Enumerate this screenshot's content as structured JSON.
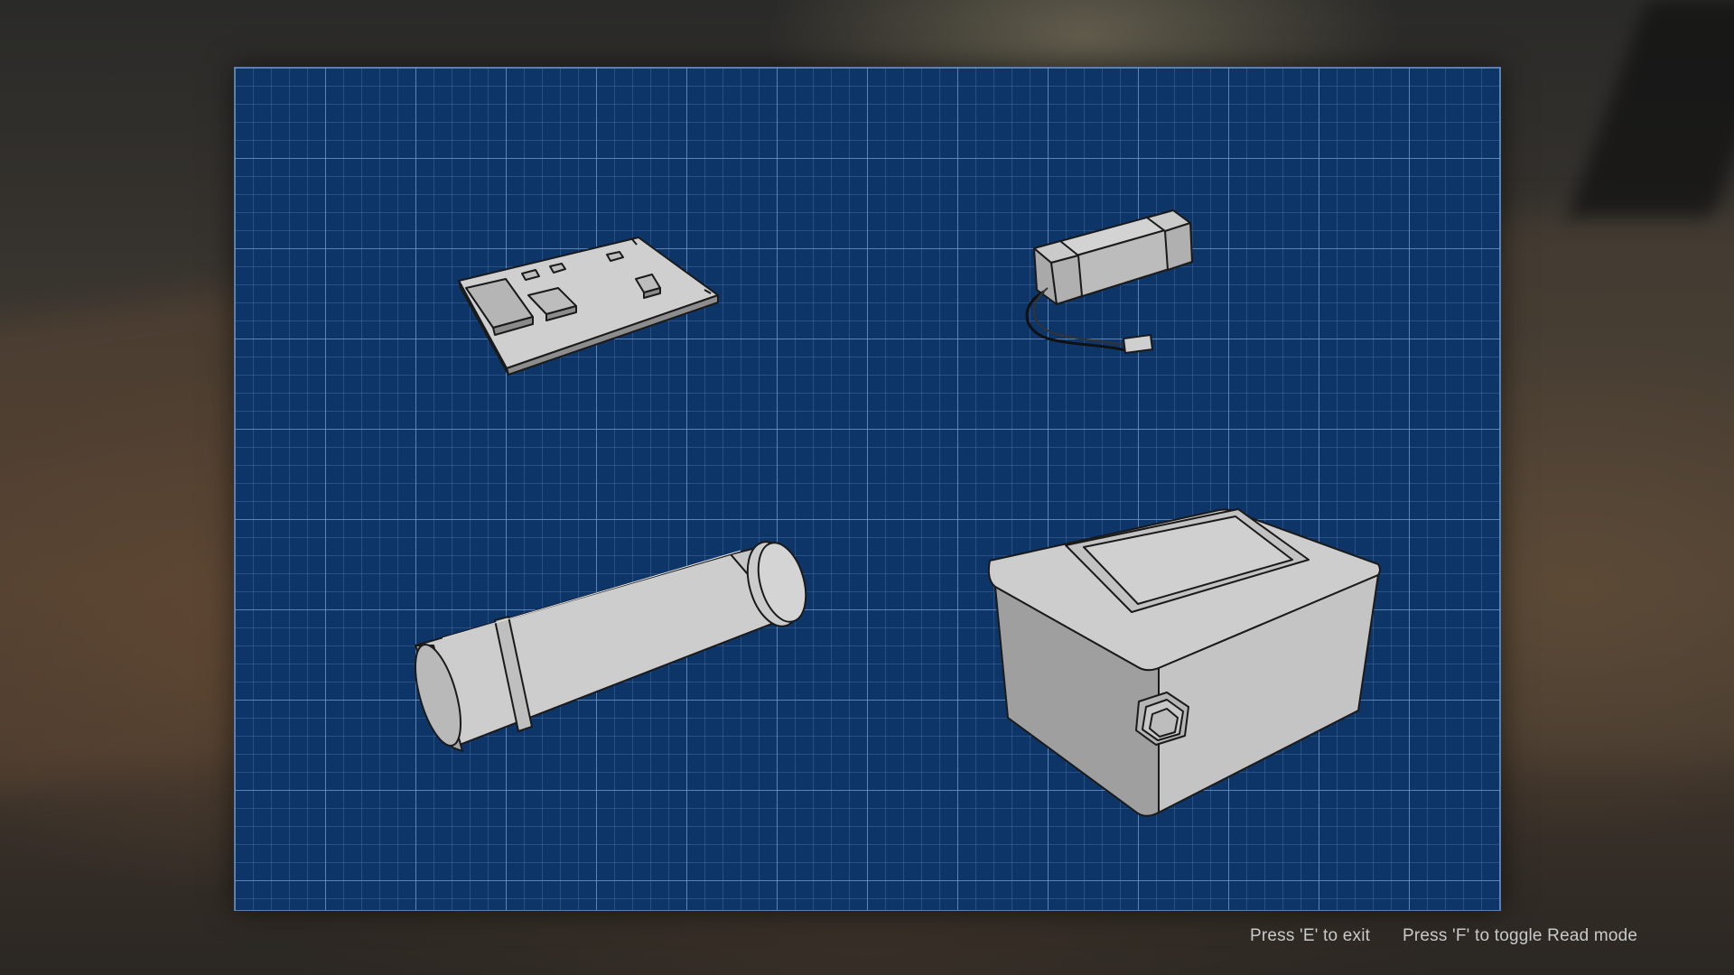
{
  "hints": {
    "exit": "Press 'E' to exit",
    "read_mode": "Press 'F' to toggle Read mode"
  },
  "blueprint": {
    "grid_color": "#0d3568",
    "line_color": "#82aadc",
    "parts": [
      "circuit-board",
      "battery-pack",
      "pipe-tube",
      "enclosure-box"
    ]
  },
  "colors": {
    "part_fill": "#c4c4c4",
    "part_shade": "#9a9a9a",
    "outline": "#1a1a1a",
    "hint_text": "#c9c9c9"
  }
}
